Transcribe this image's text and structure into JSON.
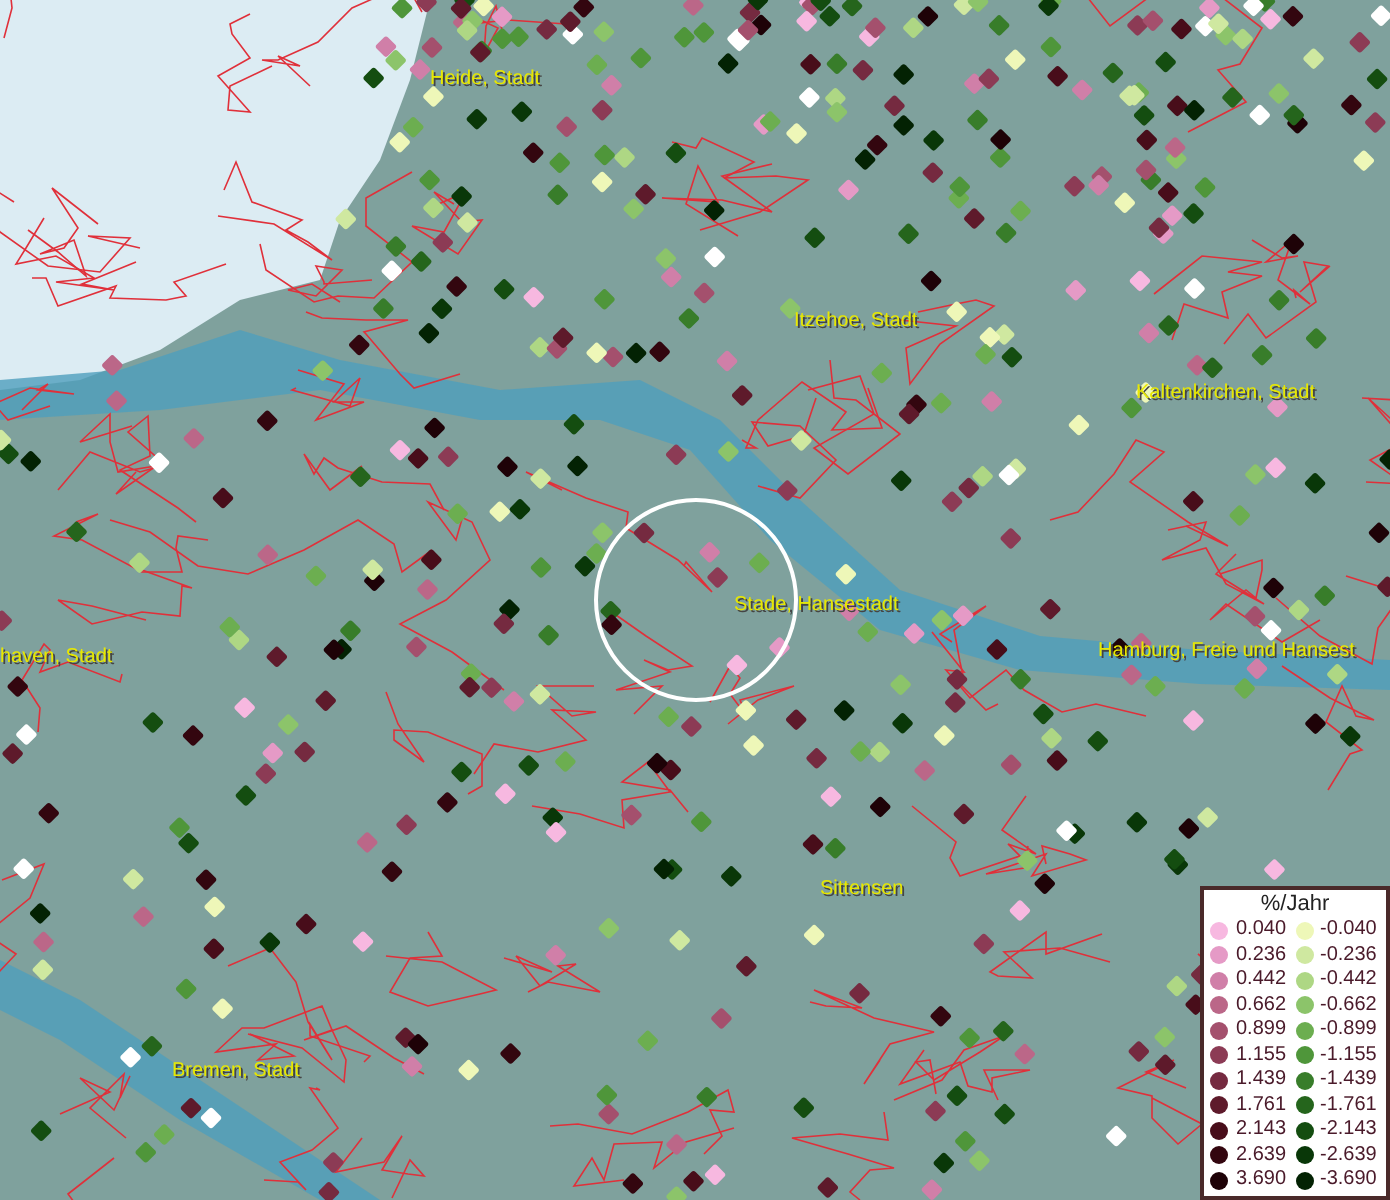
{
  "map": {
    "labels": [
      {
        "text": "Heide, Stadt"
      },
      {
        "text": "Itzehoe, Stadt"
      },
      {
        "text": "Kaltenkirchen, Stadt"
      },
      {
        "text": "Stade, Hansestadt"
      },
      {
        "text": "haven, Stadt"
      },
      {
        "text": "Hamburg, Freie und Hansest"
      },
      {
        "text": "Sittensen"
      },
      {
        "text": "Bremen, Stadt"
      }
    ]
  },
  "legend": {
    "title": "%/Jahr",
    "positive": [
      {
        "label": "0.040",
        "color": "#f7b8e0"
      },
      {
        "label": "0.236",
        "color": "#e59ac6"
      },
      {
        "label": "0.442",
        "color": "#d07fa8"
      },
      {
        "label": "0.662",
        "color": "#bb6788"
      },
      {
        "label": "0.899",
        "color": "#a4506d"
      },
      {
        "label": "1.155",
        "color": "#8c3b55"
      },
      {
        "label": "1.439",
        "color": "#752a40"
      },
      {
        "label": "1.761",
        "color": "#5e1a2b"
      },
      {
        "label": "2.143",
        "color": "#480d1a"
      },
      {
        "label": "2.639",
        "color": "#33060f"
      },
      {
        "label": "3.690",
        "color": "#1e0207"
      }
    ],
    "negative": [
      {
        "label": "-0.040",
        "color": "#eef7b8"
      },
      {
        "label": "-0.236",
        "color": "#cfe8a0"
      },
      {
        "label": "-0.442",
        "color": "#aed784"
      },
      {
        "label": "-0.662",
        "color": "#8cc46a"
      },
      {
        "label": "-0.899",
        "color": "#6cae50"
      },
      {
        "label": "-1.155",
        "color": "#4f963a"
      },
      {
        "label": "-1.439",
        "color": "#387d2a"
      },
      {
        "label": "-1.761",
        "color": "#25651c"
      },
      {
        "label": "-2.143",
        "color": "#144d10"
      },
      {
        "label": "-2.639",
        "color": "#093708"
      },
      {
        "label": "-3.690",
        "color": "#032203"
      }
    ]
  }
}
